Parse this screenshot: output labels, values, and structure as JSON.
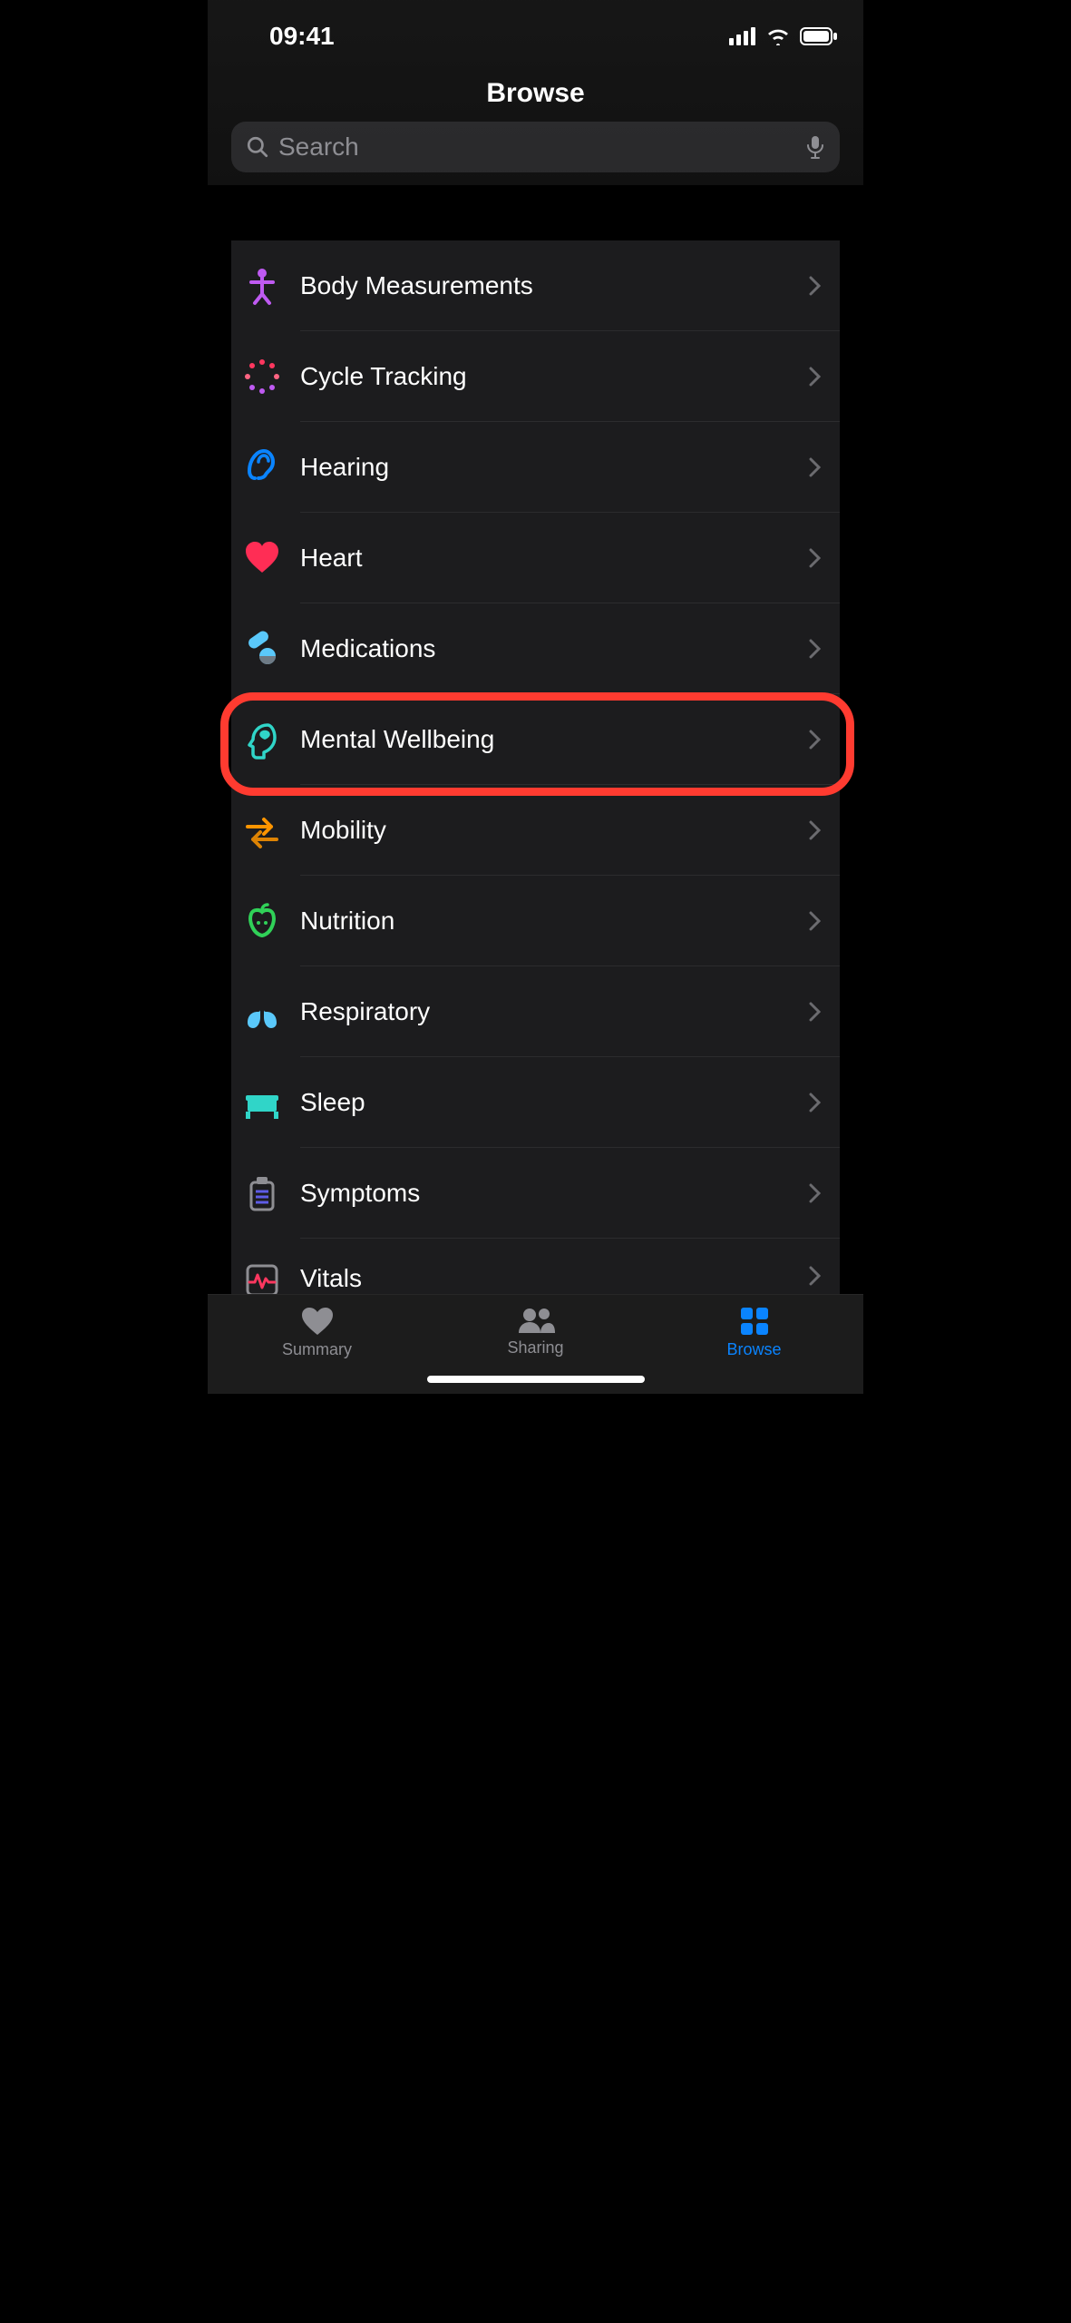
{
  "status": {
    "time": "09:41"
  },
  "header": {
    "title": "Browse"
  },
  "search": {
    "placeholder": "Search"
  },
  "categories": [
    {
      "id": "body-measurements",
      "label": "Body Measurements"
    },
    {
      "id": "cycle-tracking",
      "label": "Cycle Tracking"
    },
    {
      "id": "hearing",
      "label": "Hearing"
    },
    {
      "id": "heart",
      "label": "Heart"
    },
    {
      "id": "medications",
      "label": "Medications"
    },
    {
      "id": "mental-wellbeing",
      "label": "Mental Wellbeing",
      "highlighted": true
    },
    {
      "id": "mobility",
      "label": "Mobility"
    },
    {
      "id": "nutrition",
      "label": "Nutrition"
    },
    {
      "id": "respiratory",
      "label": "Respiratory"
    },
    {
      "id": "sleep",
      "label": "Sleep"
    },
    {
      "id": "symptoms",
      "label": "Symptoms"
    },
    {
      "id": "vitals",
      "label": "Vitals"
    }
  ],
  "tabs": [
    {
      "id": "summary",
      "label": "Summary",
      "active": false
    },
    {
      "id": "sharing",
      "label": "Sharing",
      "active": false
    },
    {
      "id": "browse",
      "label": "Browse",
      "active": true
    }
  ]
}
